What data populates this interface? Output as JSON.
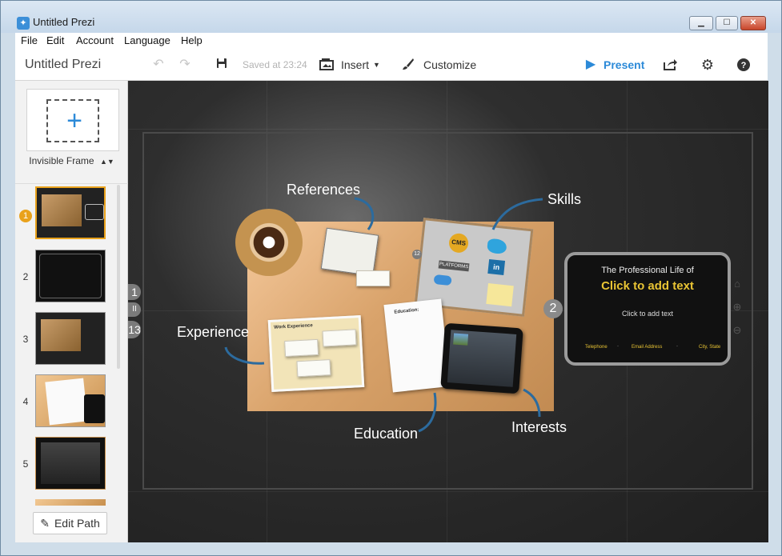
{
  "window": {
    "title": "Untitled Prezi",
    "app_icon": "prezi-app-icon",
    "minimize": "▁",
    "maximize": "☐",
    "close": "✕"
  },
  "menu": [
    "File",
    "Edit",
    "Account",
    "Language",
    "Help"
  ],
  "toolbar": {
    "doc_title": "Untitled Prezi",
    "saved_status": "Saved at 23:24",
    "insert_label": "Insert",
    "customize_label": "Customize",
    "present_label": "Present"
  },
  "sidebar": {
    "frame_type": "Invisible Frame",
    "edit_path_label": "Edit Path",
    "thumbnails": [
      {
        "number": "1",
        "active": true
      },
      {
        "number": "2",
        "active": false
      },
      {
        "number": "3",
        "active": false
      },
      {
        "number": "4",
        "active": false
      },
      {
        "number": "5",
        "active": false
      }
    ]
  },
  "canvas": {
    "labels": {
      "references": "References",
      "skills": "Skills",
      "experience": "Experience",
      "education": "Education",
      "interests": "Interests"
    },
    "path_markers": {
      "first": "1",
      "step_2": "2",
      "last": "13",
      "mini_12": "12",
      "pause": "II"
    },
    "presentation_frame": {
      "title": "The Professional Life of",
      "click_text": "Click to add text",
      "sub_text": "Click to add text",
      "footer_telephone": "Telephone",
      "footer_email": "Email Address",
      "footer_city": "City, State"
    },
    "folder_title": "Work Experience",
    "notebook_title": "Education:",
    "skills_items": [
      "CMS",
      "PLATFORMS"
    ]
  },
  "colors": {
    "accent_blue": "#2c8ad8",
    "active_orange": "#e9a21c",
    "frame_title_yellow": "#e9c434",
    "canvas_bg": "#1f1f1f"
  }
}
